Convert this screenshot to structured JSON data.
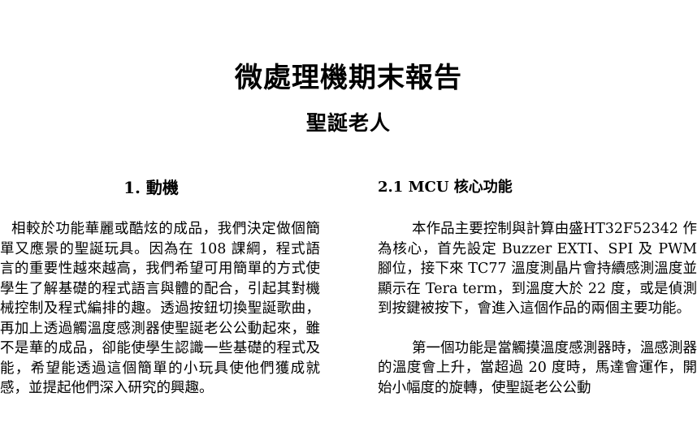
{
  "document": {
    "title": "微處理機期末報告",
    "subtitle": "聖誕老人"
  },
  "left_column": {
    "heading": "1. 動機",
    "paragraph": "相較於功能華麗或酷炫的成品，我們決定做個簡單又應景的聖誕玩具。因為在 108 課綱，程式語言的重要性越來越高，我們希望可用簡單的方式使學生了解基礎的程式語言與體的配合，引起其對機械控制及程式編排的趣。透過按鈕切換聖誕歌曲，再加上透過觸溫度感測器使聖誕老公公動起來，雖不是華的成品，卻能使學生認識一些基礎的程式及能，希望能透過這個簡單的小玩具使他們獲成就感，並提起他們深入研究的興趣。"
  },
  "right_column": {
    "heading": "2.1 MCU 核心功能",
    "paragraph_1": "本作品主要控制與計算由盛HT32F52342 作為核心，首先設定 Buzzer EXTI、SPI 及 PWM 腳位，接下來 TC77 溫度測晶片會持續感測溫度並顯示在 Tera term，到溫度大於 22 度，或是偵測到按鍵被按下，會進入這個作品的兩個主要功能。",
    "paragraph_2": "第一個功能是當觸摸溫度感測器時，溫感測器的溫度會上升，當超過 20 度時，馬達會運作，開始小幅度的旋轉，使聖誕老公公動"
  }
}
